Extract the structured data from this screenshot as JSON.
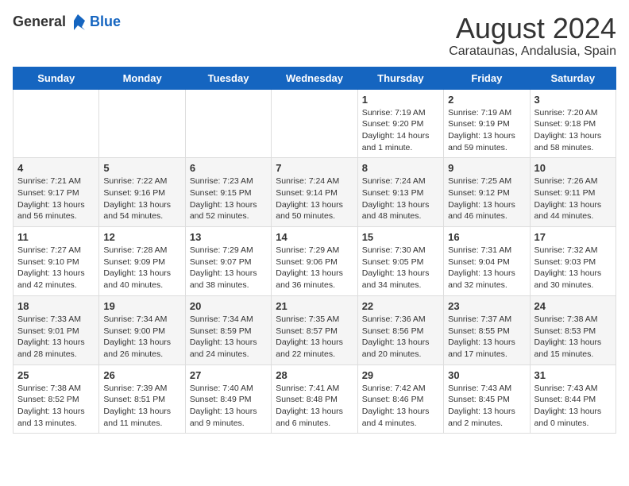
{
  "header": {
    "logo_general": "General",
    "logo_blue": "Blue",
    "main_title": "August 2024",
    "subtitle": "Carataunas, Andalusia, Spain"
  },
  "days_of_week": [
    "Sunday",
    "Monday",
    "Tuesday",
    "Wednesday",
    "Thursday",
    "Friday",
    "Saturday"
  ],
  "weeks": [
    [
      {
        "day": "",
        "info": ""
      },
      {
        "day": "",
        "info": ""
      },
      {
        "day": "",
        "info": ""
      },
      {
        "day": "",
        "info": ""
      },
      {
        "day": "1",
        "info": "Sunrise: 7:19 AM\nSunset: 9:20 PM\nDaylight: 14 hours\nand 1 minute."
      },
      {
        "day": "2",
        "info": "Sunrise: 7:19 AM\nSunset: 9:19 PM\nDaylight: 13 hours\nand 59 minutes."
      },
      {
        "day": "3",
        "info": "Sunrise: 7:20 AM\nSunset: 9:18 PM\nDaylight: 13 hours\nand 58 minutes."
      }
    ],
    [
      {
        "day": "4",
        "info": "Sunrise: 7:21 AM\nSunset: 9:17 PM\nDaylight: 13 hours\nand 56 minutes."
      },
      {
        "day": "5",
        "info": "Sunrise: 7:22 AM\nSunset: 9:16 PM\nDaylight: 13 hours\nand 54 minutes."
      },
      {
        "day": "6",
        "info": "Sunrise: 7:23 AM\nSunset: 9:15 PM\nDaylight: 13 hours\nand 52 minutes."
      },
      {
        "day": "7",
        "info": "Sunrise: 7:24 AM\nSunset: 9:14 PM\nDaylight: 13 hours\nand 50 minutes."
      },
      {
        "day": "8",
        "info": "Sunrise: 7:24 AM\nSunset: 9:13 PM\nDaylight: 13 hours\nand 48 minutes."
      },
      {
        "day": "9",
        "info": "Sunrise: 7:25 AM\nSunset: 9:12 PM\nDaylight: 13 hours\nand 46 minutes."
      },
      {
        "day": "10",
        "info": "Sunrise: 7:26 AM\nSunset: 9:11 PM\nDaylight: 13 hours\nand 44 minutes."
      }
    ],
    [
      {
        "day": "11",
        "info": "Sunrise: 7:27 AM\nSunset: 9:10 PM\nDaylight: 13 hours\nand 42 minutes."
      },
      {
        "day": "12",
        "info": "Sunrise: 7:28 AM\nSunset: 9:09 PM\nDaylight: 13 hours\nand 40 minutes."
      },
      {
        "day": "13",
        "info": "Sunrise: 7:29 AM\nSunset: 9:07 PM\nDaylight: 13 hours\nand 38 minutes."
      },
      {
        "day": "14",
        "info": "Sunrise: 7:29 AM\nSunset: 9:06 PM\nDaylight: 13 hours\nand 36 minutes."
      },
      {
        "day": "15",
        "info": "Sunrise: 7:30 AM\nSunset: 9:05 PM\nDaylight: 13 hours\nand 34 minutes."
      },
      {
        "day": "16",
        "info": "Sunrise: 7:31 AM\nSunset: 9:04 PM\nDaylight: 13 hours\nand 32 minutes."
      },
      {
        "day": "17",
        "info": "Sunrise: 7:32 AM\nSunset: 9:03 PM\nDaylight: 13 hours\nand 30 minutes."
      }
    ],
    [
      {
        "day": "18",
        "info": "Sunrise: 7:33 AM\nSunset: 9:01 PM\nDaylight: 13 hours\nand 28 minutes."
      },
      {
        "day": "19",
        "info": "Sunrise: 7:34 AM\nSunset: 9:00 PM\nDaylight: 13 hours\nand 26 minutes."
      },
      {
        "day": "20",
        "info": "Sunrise: 7:34 AM\nSunset: 8:59 PM\nDaylight: 13 hours\nand 24 minutes."
      },
      {
        "day": "21",
        "info": "Sunrise: 7:35 AM\nSunset: 8:57 PM\nDaylight: 13 hours\nand 22 minutes."
      },
      {
        "day": "22",
        "info": "Sunrise: 7:36 AM\nSunset: 8:56 PM\nDaylight: 13 hours\nand 20 minutes."
      },
      {
        "day": "23",
        "info": "Sunrise: 7:37 AM\nSunset: 8:55 PM\nDaylight: 13 hours\nand 17 minutes."
      },
      {
        "day": "24",
        "info": "Sunrise: 7:38 AM\nSunset: 8:53 PM\nDaylight: 13 hours\nand 15 minutes."
      }
    ],
    [
      {
        "day": "25",
        "info": "Sunrise: 7:38 AM\nSunset: 8:52 PM\nDaylight: 13 hours\nand 13 minutes."
      },
      {
        "day": "26",
        "info": "Sunrise: 7:39 AM\nSunset: 8:51 PM\nDaylight: 13 hours\nand 11 minutes."
      },
      {
        "day": "27",
        "info": "Sunrise: 7:40 AM\nSunset: 8:49 PM\nDaylight: 13 hours\nand 9 minutes."
      },
      {
        "day": "28",
        "info": "Sunrise: 7:41 AM\nSunset: 8:48 PM\nDaylight: 13 hours\nand 6 minutes."
      },
      {
        "day": "29",
        "info": "Sunrise: 7:42 AM\nSunset: 8:46 PM\nDaylight: 13 hours\nand 4 minutes."
      },
      {
        "day": "30",
        "info": "Sunrise: 7:43 AM\nSunset: 8:45 PM\nDaylight: 13 hours\nand 2 minutes."
      },
      {
        "day": "31",
        "info": "Sunrise: 7:43 AM\nSunset: 8:44 PM\nDaylight: 13 hours\nand 0 minutes."
      }
    ]
  ]
}
